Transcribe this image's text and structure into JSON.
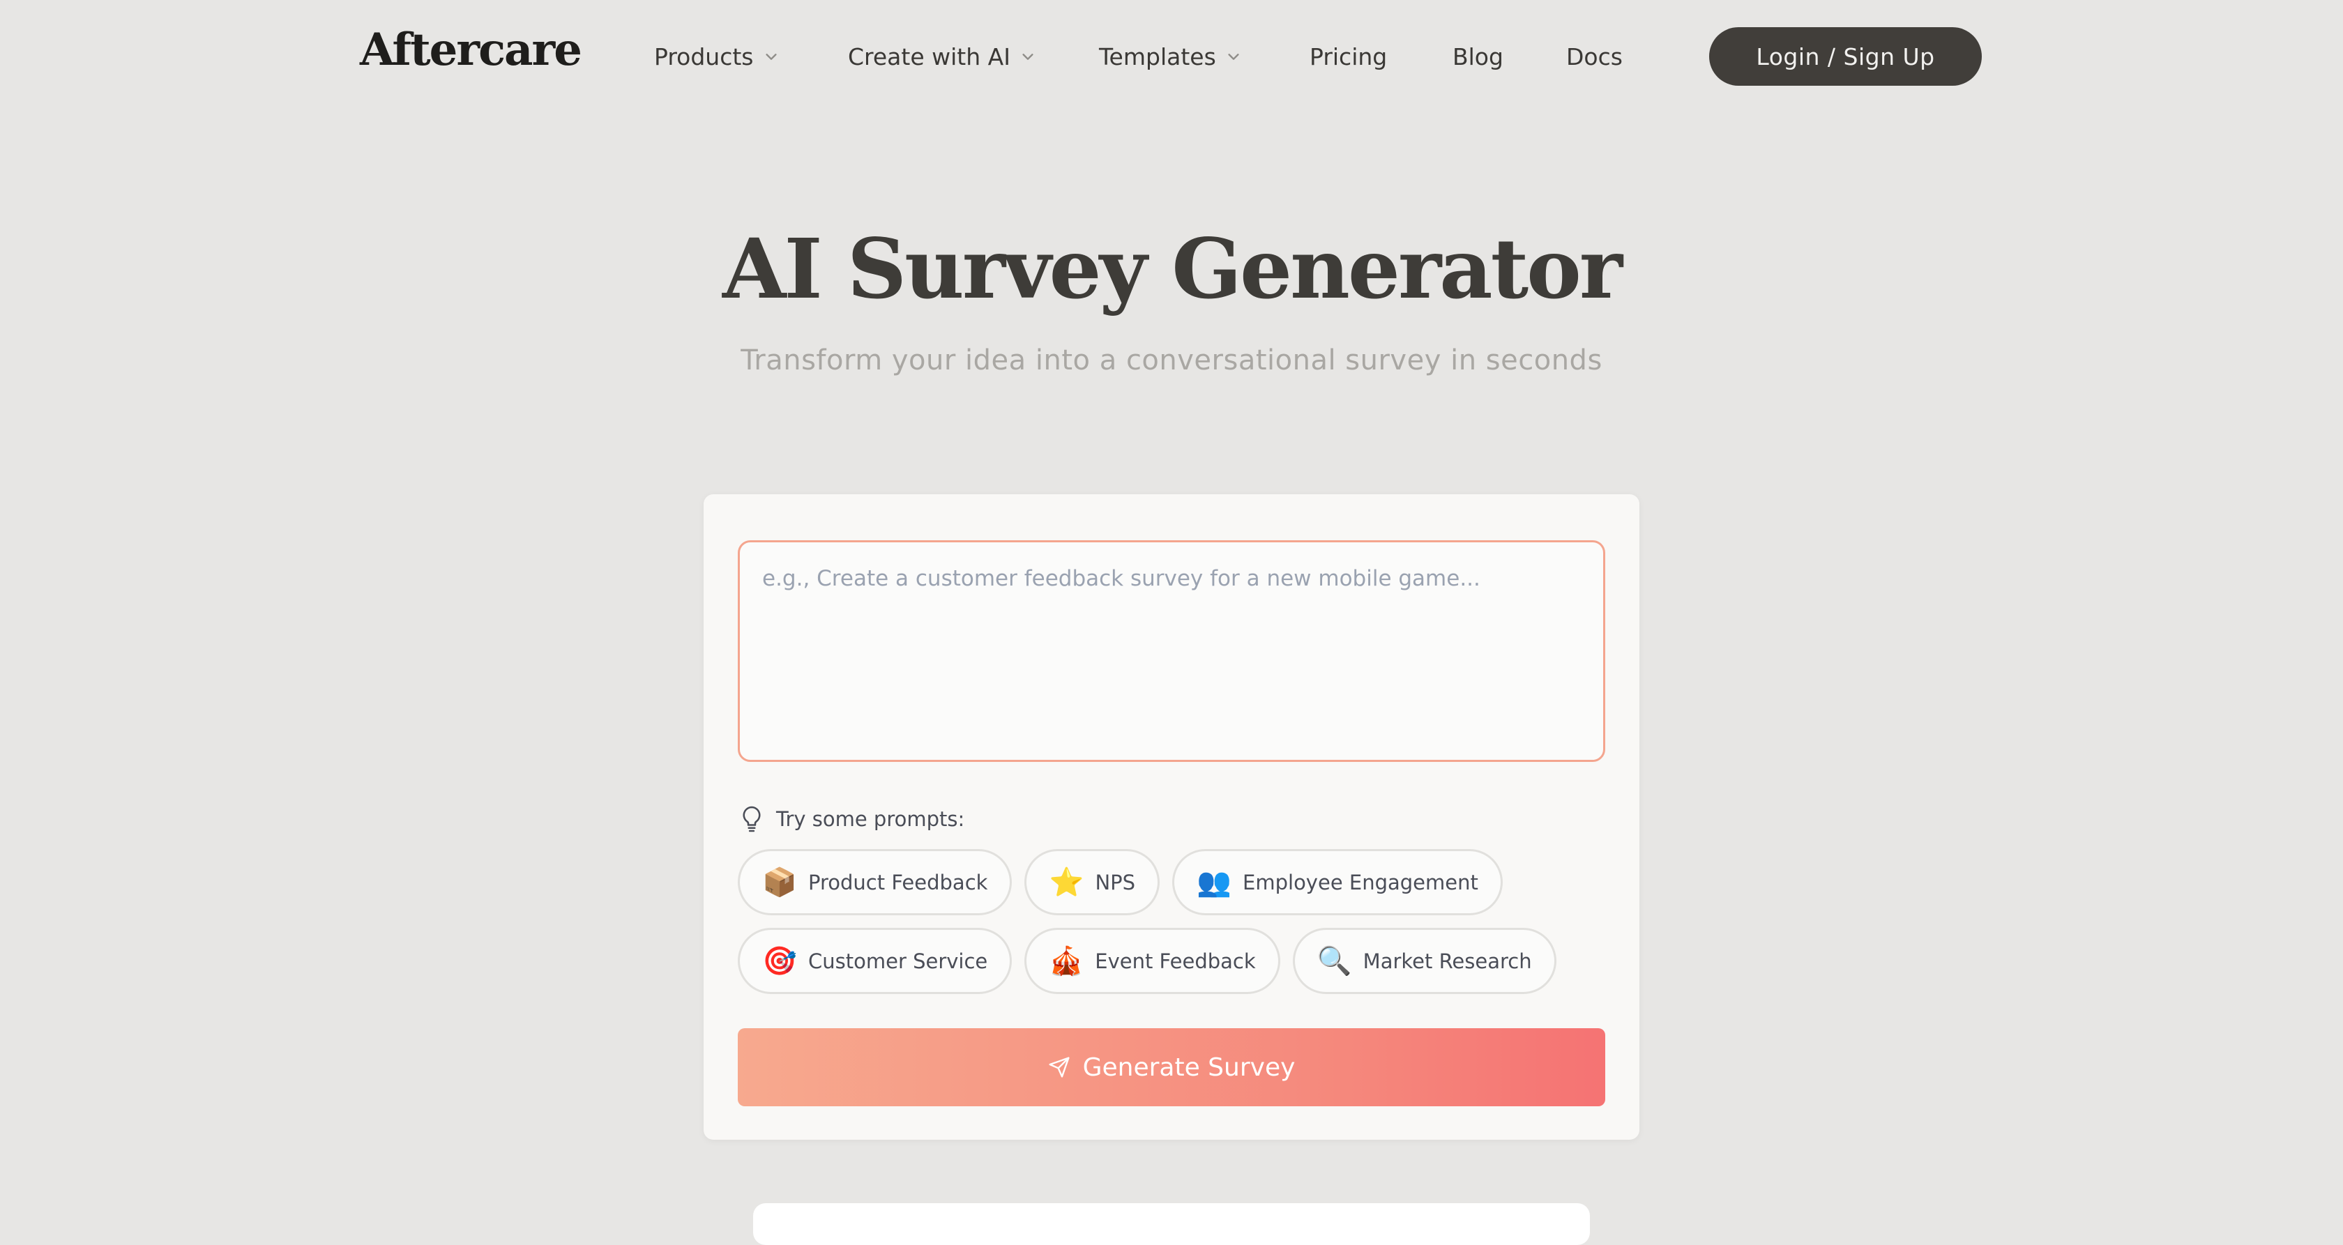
{
  "nav": {
    "logo": "Aftercare",
    "items": [
      {
        "label": "Products"
      },
      {
        "label": "Create with AI"
      },
      {
        "label": "Templates"
      },
      {
        "label": "Pricing"
      },
      {
        "label": "Blog"
      },
      {
        "label": "Docs"
      }
    ],
    "login_label": "Login / Sign Up"
  },
  "hero": {
    "title": "AI Survey Generator",
    "subtitle": "Transform your idea into a conversational survey in seconds"
  },
  "generator": {
    "placeholder": "e.g., Create a customer feedback survey for a new mobile game...",
    "value": "",
    "try_label": "Try some prompts:",
    "prompt_chips": [
      {
        "emoji": "📦",
        "label": "Product Feedback"
      },
      {
        "emoji": "⭐",
        "label": "NPS"
      },
      {
        "emoji": "👥",
        "label": "Employee Engagement"
      },
      {
        "emoji": "🎯",
        "label": "Customer Service"
      },
      {
        "emoji": "🎪",
        "label": "Event Feedback"
      },
      {
        "emoji": "🔍",
        "label": "Market Research"
      }
    ],
    "button_label": "Generate Survey"
  },
  "colors": {
    "background": "#e7e6e4",
    "login_button": "#413e3a",
    "input_border": "#f4a58e",
    "button_gradient_start": "#f7a98e",
    "button_gradient_end": "#f57373"
  }
}
